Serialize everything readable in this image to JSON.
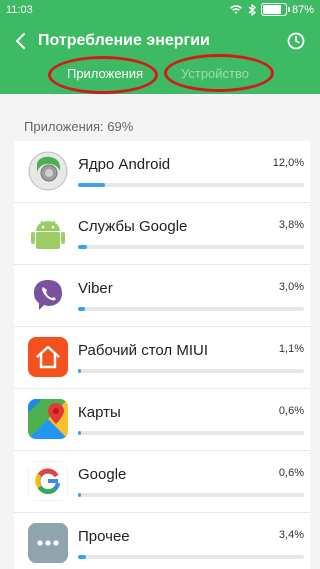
{
  "status": {
    "time": "11:03",
    "battery": "87%",
    "battery_level": 0.87
  },
  "header": {
    "title": "Потребление энергии"
  },
  "tabs": [
    {
      "label": "Приложения",
      "active": true
    },
    {
      "label": "Устройство",
      "active": false
    }
  ],
  "section_label": "Приложения: 69%",
  "apps": [
    {
      "name": "Ядро Android",
      "percent": "12,0%",
      "value": 12.0,
      "icon": "android-core-icon"
    },
    {
      "name": "Службы Google",
      "percent": "3,8%",
      "value": 3.8,
      "icon": "android-robot-icon"
    },
    {
      "name": "Viber",
      "percent": "3,0%",
      "value": 3.0,
      "icon": "viber-icon"
    },
    {
      "name": "Рабочий стол MIUI",
      "percent": "1,1%",
      "value": 1.1,
      "icon": "home-icon"
    },
    {
      "name": "Карты",
      "percent": "0,6%",
      "value": 0.6,
      "icon": "maps-icon"
    },
    {
      "name": "Google",
      "percent": "0,6%",
      "value": 0.6,
      "icon": "google-icon"
    },
    {
      "name": "Прочее",
      "percent": "3,4%",
      "value": 3.4,
      "icon": "more-icon"
    }
  ],
  "colors": {
    "accent": "#3dba63",
    "bar": "#39a2f2",
    "highlight_ring": "#d11a1a"
  }
}
